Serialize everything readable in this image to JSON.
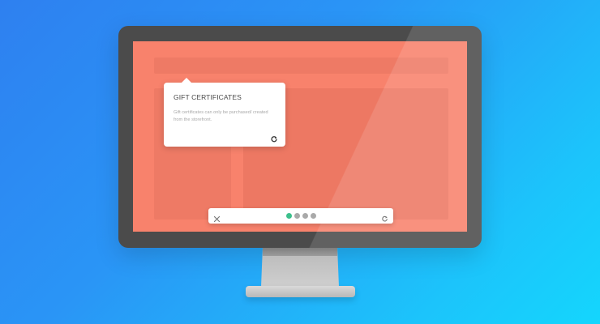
{
  "popover": {
    "title": "GIFT CERTIFICATES",
    "body": "Gift certificates can only be purchased/ created from the storefront.",
    "action_icon": "refresh-icon"
  },
  "tour_bar": {
    "close_icon": "close-icon",
    "restart_icon": "restart-icon",
    "steps": [
      {
        "state": "active"
      },
      {
        "state": "inactive"
      },
      {
        "state": "inactive"
      },
      {
        "state": "inactive"
      }
    ],
    "current_step": 1,
    "total_steps": 4
  },
  "colors": {
    "background_start": "#2e80f0",
    "background_end": "#14d6fd",
    "screen": "#f8826c",
    "monitor_bezel": "#4b4b4b",
    "active_dot": "#3cc08c",
    "inactive_dot": "#a9a9a9"
  }
}
